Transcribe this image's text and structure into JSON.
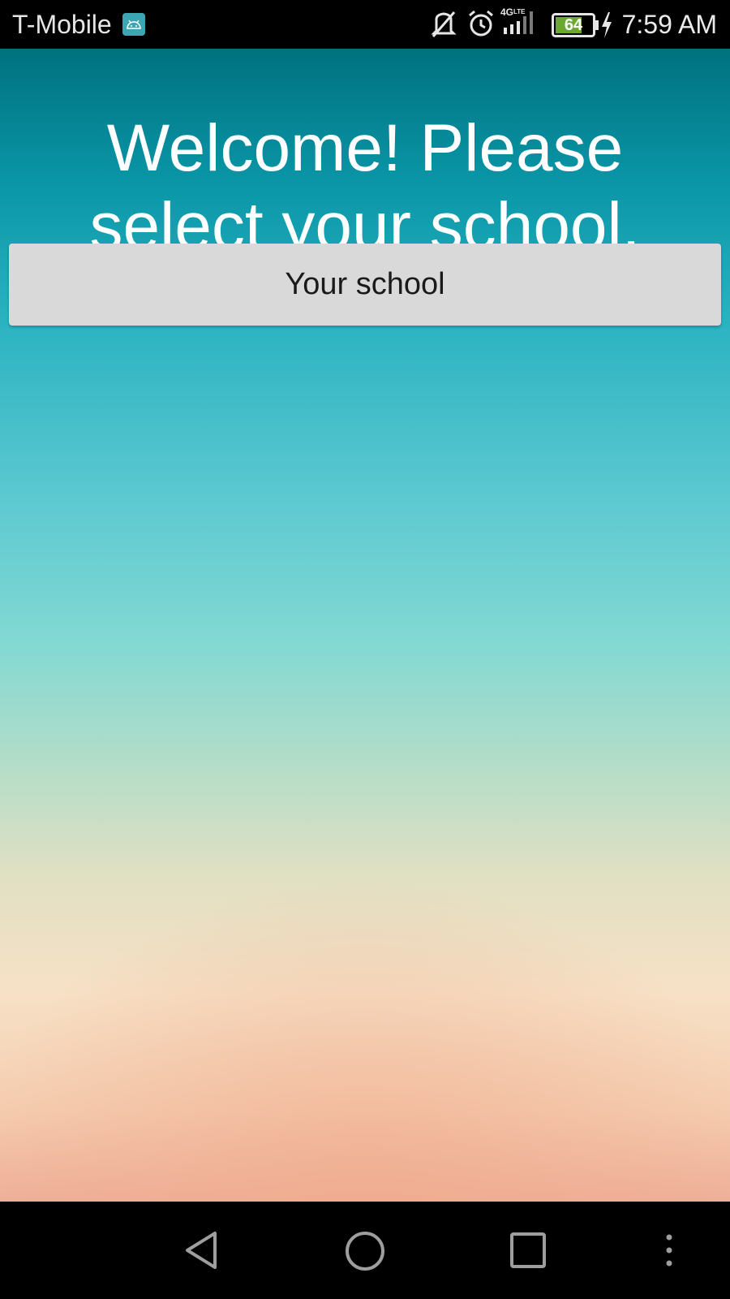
{
  "status_bar": {
    "carrier": "T-Mobile",
    "network_label": "4G LTE",
    "battery_level": "64",
    "time": "7:59 AM",
    "icons": [
      "android-icon",
      "mute-icon",
      "alarm-icon",
      "signal-icon",
      "battery-icon",
      "charging-icon"
    ]
  },
  "main": {
    "title": "Welcome! Please select your school.",
    "school_button_label": "Your school"
  },
  "nav_bar": {
    "icons": [
      "back-icon",
      "home-icon",
      "recents-icon",
      "overflow-menu-icon"
    ]
  },
  "colors": {
    "status_bar_bg": "#000000",
    "gradient_top": "#00717f",
    "gradient_mid": "#84d9d3",
    "gradient_bottom": "#eeaf98",
    "button_bg": "#d9d9d9",
    "battery_fill": "#6aa832"
  }
}
